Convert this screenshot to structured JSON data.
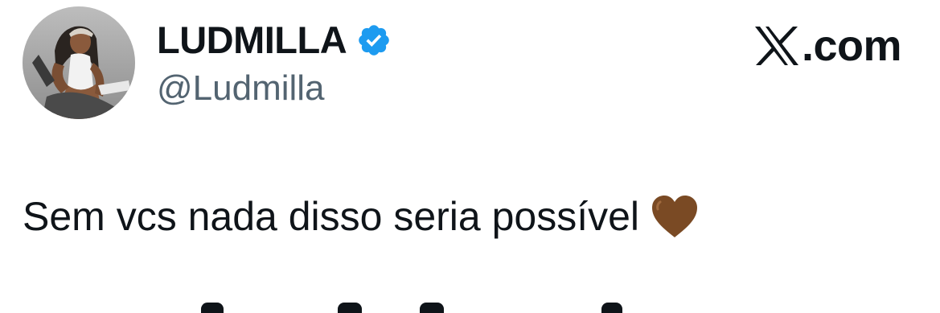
{
  "source": {
    "domain": ".com",
    "logo_icon": "x-logo-icon"
  },
  "author": {
    "display_name": "LUDMILLA",
    "handle": "@Ludmilla",
    "verified_icon": "verified-badge-icon",
    "verified_color": "#1d9bf0",
    "avatar_icon": "avatar-photo"
  },
  "tweet": {
    "text": "Sem vcs nada disso seria possível",
    "emoji_icon": "brown-heart-icon",
    "emoji_color": "#7a4a24"
  },
  "colors": {
    "text_primary": "#0f1419",
    "text_secondary": "#536471",
    "background": "#ffffff"
  }
}
